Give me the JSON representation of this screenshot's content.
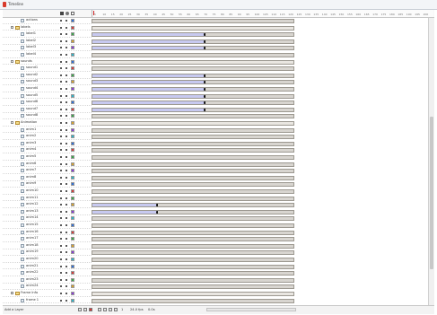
{
  "window": {
    "title": "Timeline"
  },
  "ruler": {
    "ticks": [
      "5",
      "10",
      "15",
      "20",
      "25",
      "30",
      "35",
      "40",
      "45",
      "50",
      "55",
      "60",
      "65",
      "70",
      "75",
      "80",
      "85",
      "90",
      "95",
      "100",
      "105",
      "110",
      "115",
      "120",
      "125",
      "130",
      "135",
      "140",
      "145",
      "150",
      "155",
      "160",
      "165",
      "170",
      "175",
      "180",
      "185",
      "190",
      "195",
      "200"
    ]
  },
  "layers": [
    {
      "type": "layer",
      "depth": 1,
      "label": "actions"
    },
    {
      "type": "folder",
      "depth": 0,
      "label": "labels"
    },
    {
      "type": "layer",
      "depth": 1,
      "label": "label1",
      "frames": 0.56
    },
    {
      "type": "layer",
      "depth": 1,
      "label": "label2",
      "frames": 0.56
    },
    {
      "type": "layer",
      "depth": 1,
      "label": "label3",
      "frames": 0.56
    },
    {
      "type": "layer",
      "depth": 1,
      "label": "label4"
    },
    {
      "type": "folder",
      "depth": 0,
      "label": "sounds"
    },
    {
      "type": "layer",
      "depth": 1,
      "label": "sound1"
    },
    {
      "type": "layer",
      "depth": 1,
      "label": "sound2",
      "frames": 0.56
    },
    {
      "type": "layer",
      "depth": 1,
      "label": "sound3",
      "frames": 0.56
    },
    {
      "type": "layer",
      "depth": 1,
      "label": "sound4",
      "frames": 0.56
    },
    {
      "type": "layer",
      "depth": 1,
      "label": "sound5",
      "frames": 0.56
    },
    {
      "type": "layer",
      "depth": 1,
      "label": "sound6",
      "frames": 0.56
    },
    {
      "type": "layer",
      "depth": 1,
      "label": "sound7",
      "frames": 0.56
    },
    {
      "type": "layer",
      "depth": 1,
      "label": "sound8"
    },
    {
      "type": "folder",
      "depth": 0,
      "label": "Animation"
    },
    {
      "type": "layer",
      "depth": 1,
      "label": "anim1"
    },
    {
      "type": "layer",
      "depth": 1,
      "label": "anim2"
    },
    {
      "type": "layer",
      "depth": 1,
      "label": "anim3"
    },
    {
      "type": "layer",
      "depth": 1,
      "label": "anim4"
    },
    {
      "type": "layer",
      "depth": 1,
      "label": "anim5"
    },
    {
      "type": "layer",
      "depth": 1,
      "label": "anim6"
    },
    {
      "type": "layer",
      "depth": 1,
      "label": "anim7"
    },
    {
      "type": "layer",
      "depth": 1,
      "label": "anim8"
    },
    {
      "type": "layer",
      "depth": 1,
      "label": "anim9"
    },
    {
      "type": "layer",
      "depth": 1,
      "label": "anim10"
    },
    {
      "type": "layer",
      "depth": 1,
      "label": "anim11"
    },
    {
      "type": "layer",
      "depth": 1,
      "label": "anim12",
      "frames": 0.32
    },
    {
      "type": "layer",
      "depth": 1,
      "label": "anim13",
      "frames": 0.32
    },
    {
      "type": "layer",
      "depth": 1,
      "label": "anim14"
    },
    {
      "type": "layer",
      "depth": 1,
      "label": "anim15"
    },
    {
      "type": "layer",
      "depth": 1,
      "label": "anim16"
    },
    {
      "type": "layer",
      "depth": 1,
      "label": "anim17"
    },
    {
      "type": "layer",
      "depth": 1,
      "label": "anim18"
    },
    {
      "type": "layer",
      "depth": 1,
      "label": "anim19"
    },
    {
      "type": "layer",
      "depth": 1,
      "label": "anim20"
    },
    {
      "type": "layer",
      "depth": 1,
      "label": "anim21"
    },
    {
      "type": "layer",
      "depth": 1,
      "label": "anim22"
    },
    {
      "type": "layer",
      "depth": 1,
      "label": "anim23"
    },
    {
      "type": "layer",
      "depth": 1,
      "label": "anim24"
    },
    {
      "type": "folder",
      "depth": 0,
      "label": "Frame Info"
    },
    {
      "type": "layer",
      "depth": 1,
      "label": "frame 1"
    }
  ],
  "bottom_bar": {
    "left_label": "Add a Layer",
    "frame_number": "1",
    "fps": "24.0 fps",
    "time": "0.0s"
  },
  "colors": {
    "frame_fill": "#c7c9f0",
    "track_fill": "#d8d5d0",
    "playhead": "#cc2222",
    "app_icon": "#d83a2c"
  }
}
